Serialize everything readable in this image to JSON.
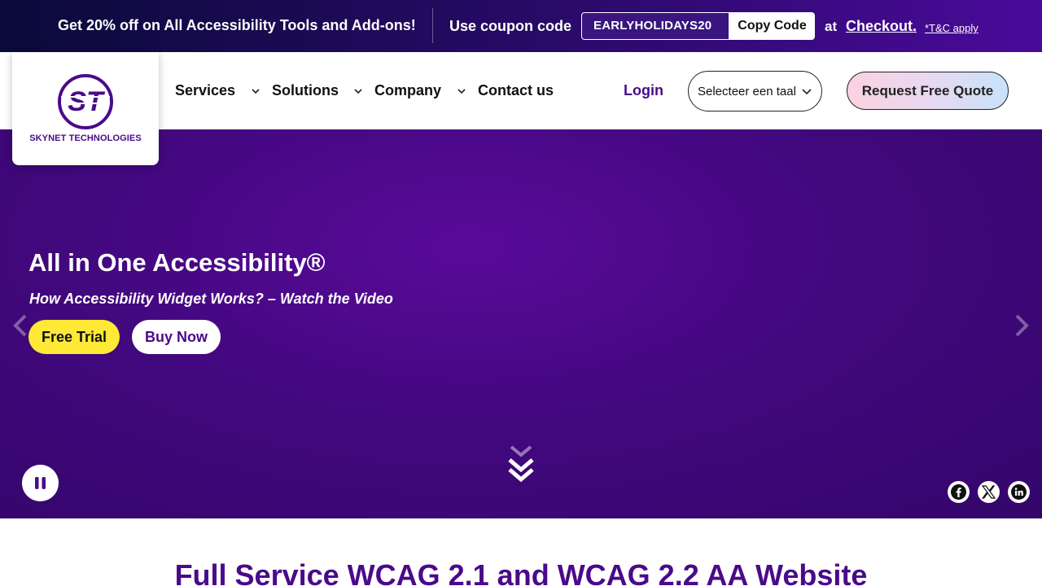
{
  "promo": {
    "offer_text": "Get 20% off on All Accessibility Tools and Add-ons!",
    "use_coupon_text": "Use coupon code",
    "coupon_code": "EARLYHOLIDAYS20",
    "copy_code_label": "Copy Code",
    "at_text": "at",
    "checkout_label": "Checkout",
    "period": ".",
    "terms_label": "*T&C apply"
  },
  "header": {
    "logo_text": "SKYNET TECHNOLOGIES",
    "nav": [
      {
        "label": "Services"
      },
      {
        "label": "Solutions"
      },
      {
        "label": "Company"
      },
      {
        "label": "Contact us"
      }
    ],
    "login_label": "Login",
    "language_select_value": "Selecteer een taal",
    "quote_label": "Request Free Quote"
  },
  "hero": {
    "title": "All in One Accessibility®",
    "subtitle": "How Accessibility Widget Works? – Watch the Video",
    "free_trial_label": "Free Trial",
    "buy_now_label": "Buy Now"
  },
  "section": {
    "heading": "Full Service WCAG 2.1 and WCAG 2.2 AA Website"
  },
  "colors": {
    "brand_purple": "#4a0a8a",
    "hero_bg": "#43087f",
    "trial_yellow": "#ffe936"
  },
  "icons": [
    "chevron-down-icon",
    "pause-icon",
    "scroll-down-icon",
    "facebook-icon",
    "x-icon",
    "linkedin-icon",
    "arrow-left-icon",
    "arrow-right-icon"
  ]
}
